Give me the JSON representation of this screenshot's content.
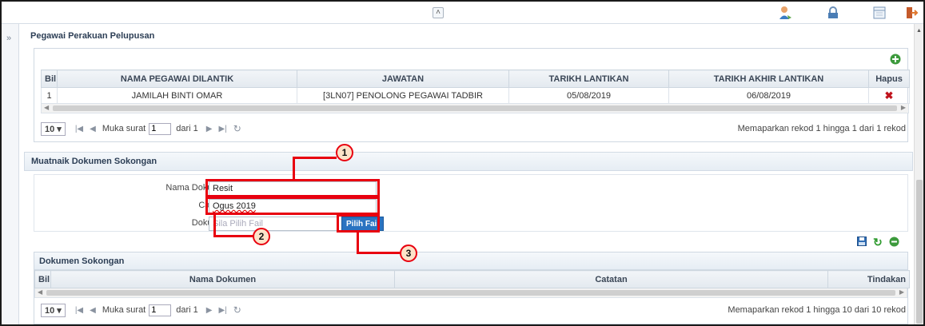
{
  "icons": {
    "collapse_top": "double-chevron-up-icon",
    "expand_left": "double-chevron-right-icon",
    "user": "user-icon",
    "lock": "lock-icon",
    "calendar": "calendar-icon",
    "logout": "logout-icon",
    "add": "add-icon",
    "delete": "delete-icon",
    "refresh": "refresh-icon",
    "save": "save-icon",
    "reload": "reload-icon",
    "minus": "minus-icon"
  },
  "pegawai": {
    "title": "Pegawai Perakuan Pelupusan",
    "columns": [
      "Bil",
      "NAMA PEGAWAI DILANTIK",
      "JAWATAN",
      "TARIKH LANTIKAN",
      "TARIKH AKHIR LANTIKAN",
      "Hapus"
    ],
    "rows": [
      {
        "bil": "1",
        "nama": "JAMILAH BINTI OMAR",
        "jawatan": "[3LN07] PENOLONG PEGAWAI TADBIR",
        "tarikh": "05/08/2019",
        "tarikh_akhir": "06/08/2019"
      }
    ],
    "pager": {
      "page_size": "10",
      "page_label": "Muka surat",
      "page_value": "1",
      "of_label": "dari 1",
      "info": "Memaparkan rekod 1 hingga 1 dari 1 rekod"
    }
  },
  "muatnaik": {
    "title": "Muatnaik Dokumen Sokongan",
    "nama_label": "Nama Dokumen :",
    "nama_value": "Resit",
    "catatan_label": "Catatan :",
    "catatan_value": "Ogus 2019",
    "dokumen_label": "Dokumen :",
    "dokumen_placeholder": "Sila Pilih Fail",
    "pilih_button": "Pilih Fail"
  },
  "dokumen": {
    "title": "Dokumen Sokongan",
    "columns": [
      "Bil",
      "Nama Dokumen",
      "Catatan",
      "Tindakan"
    ],
    "pager": {
      "page_size": "10",
      "page_label": "Muka surat",
      "page_value": "1",
      "of_label": "dari 1",
      "info": "Memaparkan rekod 1 hingga 10 dari 10 rekod"
    }
  },
  "annotations": [
    "1",
    "2",
    "3"
  ],
  "colors": {
    "annotation": "#e8000f",
    "button": "#2a73c1"
  }
}
